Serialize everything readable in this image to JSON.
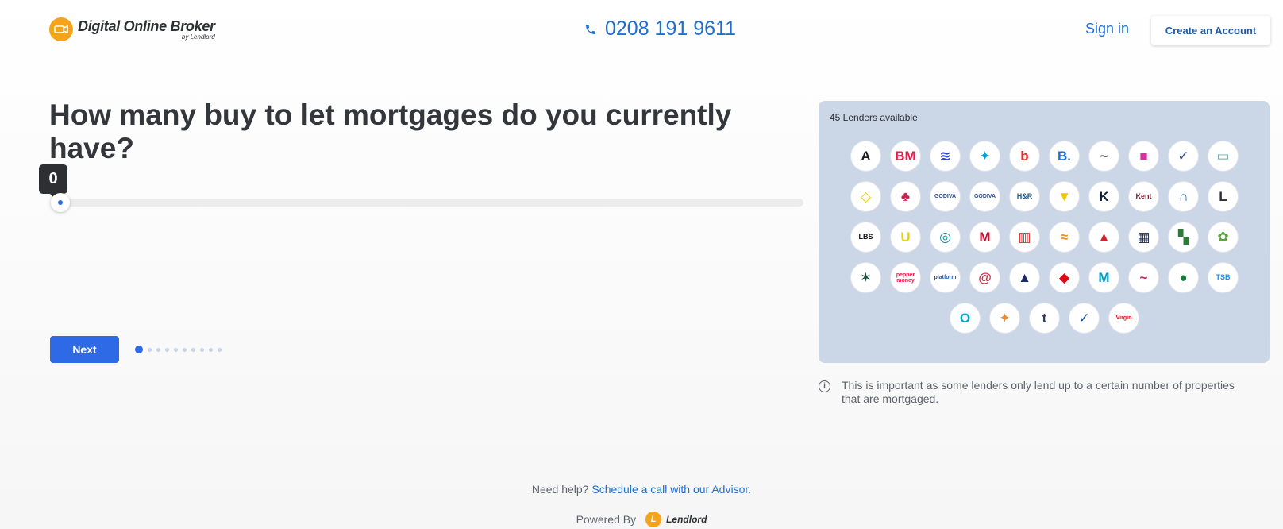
{
  "header": {
    "brand_title": "Digital Online Broker",
    "brand_sub": "by Lendlord",
    "phone": "0208 191 9611",
    "signin_label": "Sign in",
    "create_account_label": "Create an Account"
  },
  "question": {
    "title": "How many buy to let mortgages do you currently have?",
    "slider_value": "0",
    "next_label": "Next",
    "step_current": 1,
    "step_total": 10
  },
  "lenders_panel": {
    "title": "45 Lenders available",
    "lenders": [
      {
        "label": "A",
        "color": "#1a1a1a"
      },
      {
        "label": "BM",
        "color": "#e8194b"
      },
      {
        "label": "≋",
        "color": "#2a3fd1"
      },
      {
        "label": "✦",
        "color": "#00a3e0"
      },
      {
        "label": "b",
        "color": "#e52d27"
      },
      {
        "label": "B.",
        "color": "#1f6fd0"
      },
      {
        "label": "~",
        "color": "#5e6168"
      },
      {
        "label": "■",
        "color": "#d3339b"
      },
      {
        "label": "✓",
        "color": "#2d4c8c"
      },
      {
        "label": "▭",
        "color": "#6bb0a8"
      },
      {
        "label": "◇",
        "color": "#f2c500"
      },
      {
        "label": "♣",
        "color": "#c8234e"
      },
      {
        "label": "GODIVA",
        "color": "#2a4d8f"
      },
      {
        "label": "GODIVA",
        "color": "#2a4d8f"
      },
      {
        "label": "H&R",
        "color": "#1b5a8a"
      },
      {
        "label": "▼",
        "color": "#f2c500"
      },
      {
        "label": "K",
        "color": "#0b1f3a"
      },
      {
        "label": "Kent",
        "color": "#7a1d2e"
      },
      {
        "label": "∩",
        "color": "#1f6fd0"
      },
      {
        "label": "L",
        "color": "#2d2f33"
      },
      {
        "label": "LBS",
        "color": "#111111"
      },
      {
        "label": "U",
        "color": "#e6d200"
      },
      {
        "label": "◎",
        "color": "#1a8a9a"
      },
      {
        "label": "M",
        "color": "#c8102e"
      },
      {
        "label": "▥",
        "color": "#e52d27"
      },
      {
        "label": "≈",
        "color": "#f28c28"
      },
      {
        "label": "▲",
        "color": "#d12230"
      },
      {
        "label": "▦",
        "color": "#1c2a4a"
      },
      {
        "label": "▚",
        "color": "#2f7a3a"
      },
      {
        "label": "✿",
        "color": "#58a63a"
      },
      {
        "label": "✶",
        "color": "#1a4a3a"
      },
      {
        "label": "pepper money",
        "color": "#e8194b"
      },
      {
        "label": "platform",
        "color": "#1f4fa0"
      },
      {
        "label": "@",
        "color": "#c9304b"
      },
      {
        "label": "▲",
        "color": "#1c2a6a"
      },
      {
        "label": "◆",
        "color": "#e30613"
      },
      {
        "label": "M",
        "color": "#00a0c6"
      },
      {
        "label": "~",
        "color": "#c8234e"
      },
      {
        "label": "●",
        "color": "#1a7a3a"
      },
      {
        "label": "TSB",
        "color": "#1e88e5"
      },
      {
        "label": "O",
        "color": "#00a6d6"
      },
      {
        "label": "✦",
        "color": "#f28c28"
      },
      {
        "label": "t",
        "color": "#2d3a5a"
      },
      {
        "label": "✓",
        "color": "#1f4fa0"
      },
      {
        "label": "Virgin",
        "color": "#e30613"
      }
    ],
    "info_text": "This is important as some lenders only lend up to a certain number of properties that are mortgaged."
  },
  "footer": {
    "help_prefix": "Need help?",
    "help_link": "Schedule a call with our Advisor.",
    "powered_by": "Powered By",
    "powered_name": "Lendlord"
  },
  "colors": {
    "accent": "#2f6ae6",
    "link": "#1f6fd0",
    "brand_orange": "#f5a31c",
    "panel_bg": "#cbd6e6"
  }
}
